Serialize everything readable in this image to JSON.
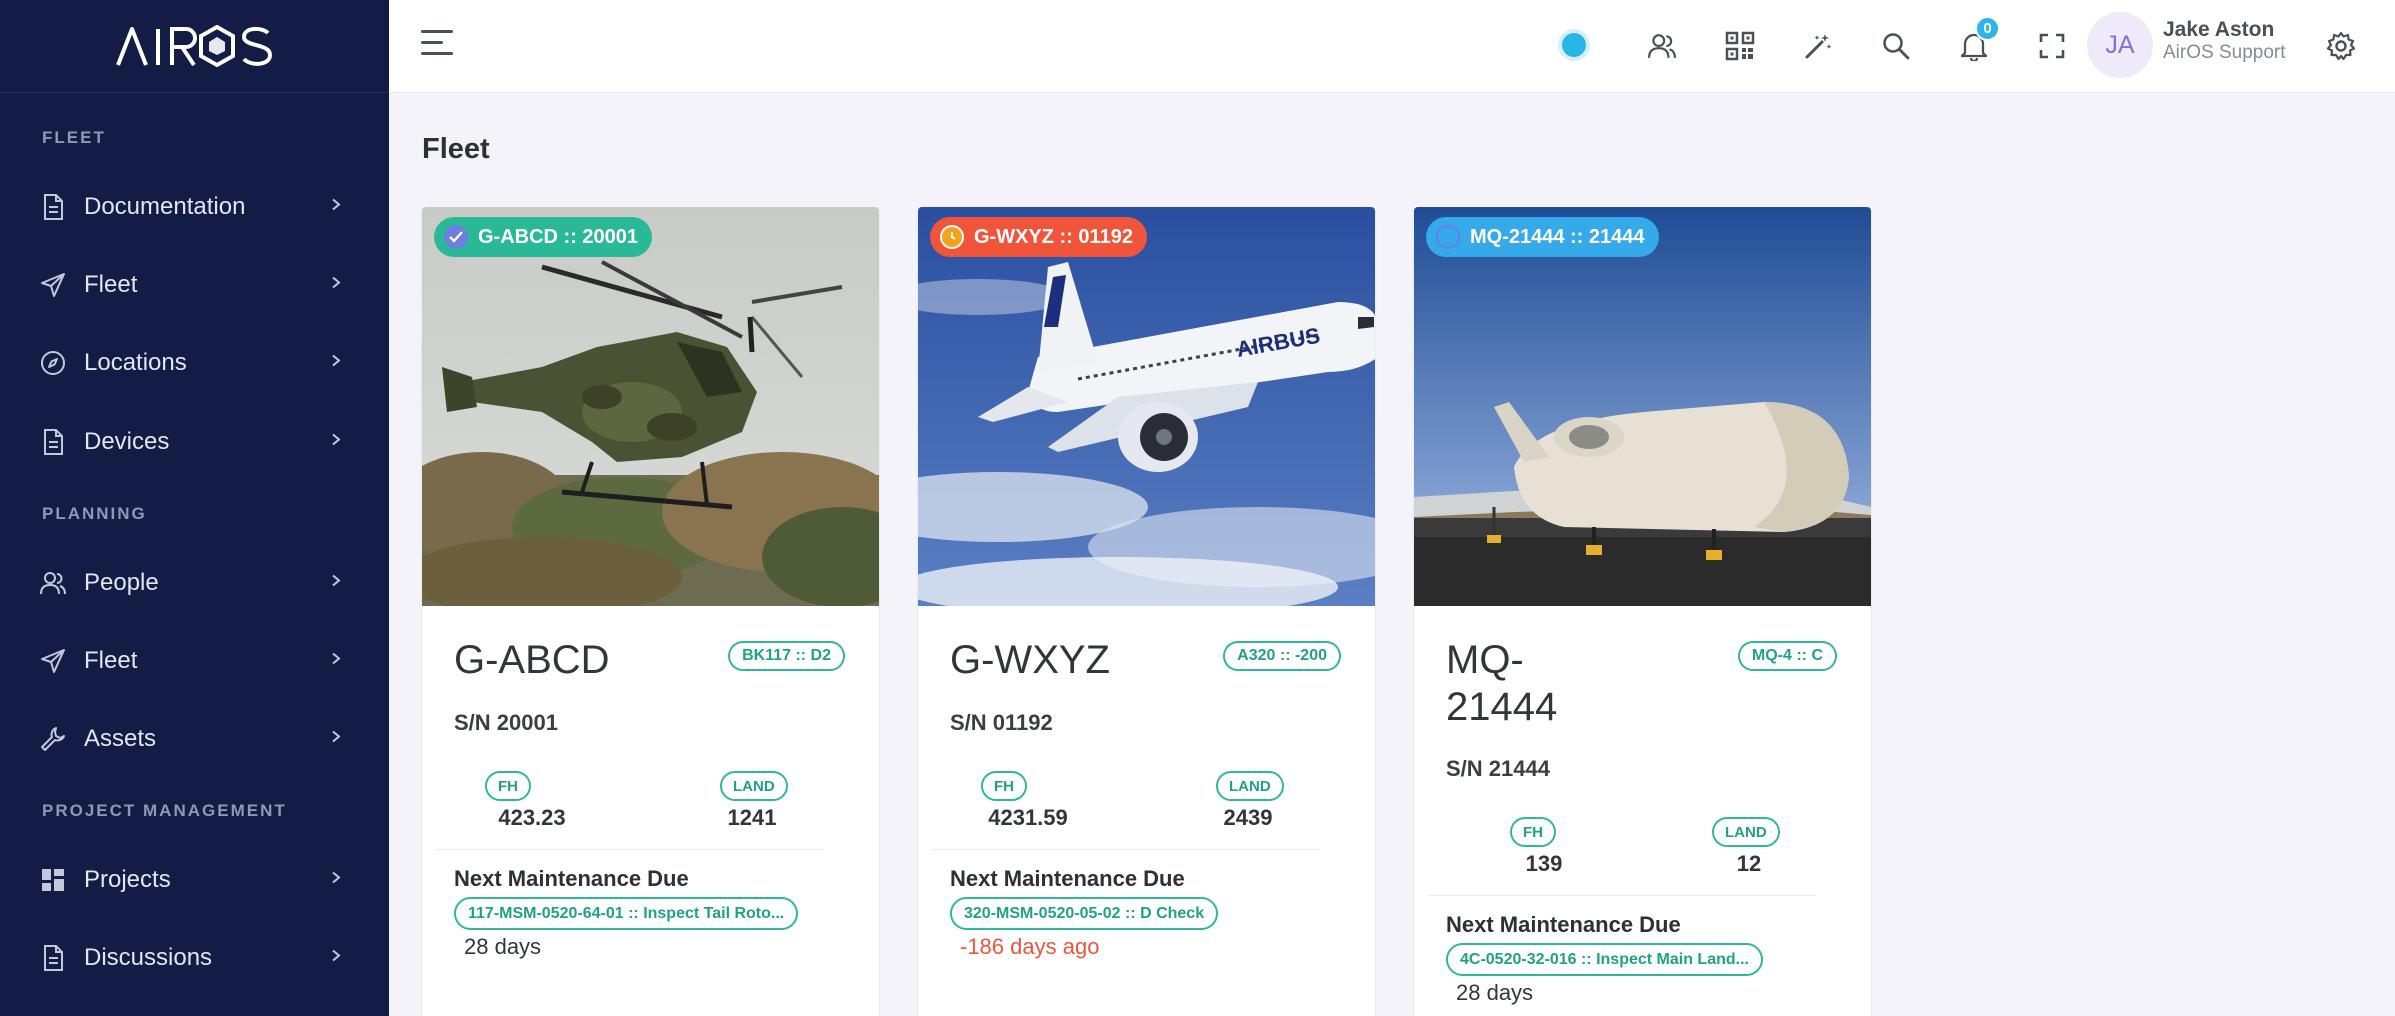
{
  "brand": {
    "logo_text": "AIROS"
  },
  "sidebar": {
    "sections": [
      {
        "title": "FLEET"
      },
      {
        "title": "PLANNING"
      },
      {
        "title": "PROJECT MANAGEMENT"
      }
    ],
    "items": [
      {
        "label": "Documentation",
        "icon": "document-icon"
      },
      {
        "label": "Fleet",
        "icon": "paper-plane-icon"
      },
      {
        "label": "Locations",
        "icon": "compass-icon"
      },
      {
        "label": "Devices",
        "icon": "document-icon"
      },
      {
        "label": "People",
        "icon": "people-icon"
      },
      {
        "label": "Fleet",
        "icon": "paper-plane-icon"
      },
      {
        "label": "Assets",
        "icon": "wrench-icon"
      },
      {
        "label": "Projects",
        "icon": "grid-icon"
      },
      {
        "label": "Discussions",
        "icon": "document-icon"
      }
    ]
  },
  "topbar": {
    "notification_count": "0",
    "user": {
      "initials": "JA",
      "name": "Jake Aston",
      "role": "AirOS Support"
    }
  },
  "page": {
    "title": "Fleet"
  },
  "cards": [
    {
      "pill_label": "G-ABCD :: 20001",
      "pill_status": "complete",
      "pill_color": "#2ab996",
      "tail": "G-ABCD",
      "type": "BK117 :: D2",
      "serial": "S/N 20001",
      "fh_label": "FH",
      "fh_value": "423.23",
      "land_label": "LAND",
      "land_value": "1241",
      "next_title": "Next Maintenance Due",
      "task": "117-MSM-0520-64-01 :: Inspect Tail Roto...",
      "due": "28 days",
      "overdue": false
    },
    {
      "pill_label": "G-WXYZ :: 01192",
      "pill_status": "warning",
      "pill_color": "#f0553a",
      "tail": "G-WXYZ",
      "type": "A320 :: -200",
      "serial": "S/N 01192",
      "fh_label": "FH",
      "fh_value": "4231.59",
      "land_label": "LAND",
      "land_value": "2439",
      "next_title": "Next Maintenance Due",
      "task": "320-MSM-0520-05-02 :: D Check",
      "due": "-186 days ago",
      "overdue": true
    },
    {
      "pill_label": "MQ-21444 :: 21444",
      "pill_status": "pending",
      "pill_color": "#35a9ea",
      "tail_line1": "MQ-",
      "tail_line2": "21444",
      "type": "MQ-4 :: C",
      "serial": "S/N 21444",
      "fh_label": "FH",
      "fh_value": "139",
      "land_label": "LAND",
      "land_value": "12",
      "next_title": "Next Maintenance Due",
      "task": "4C-0520-32-016 :: Inspect Main Land...",
      "due": "28 days",
      "overdue": false
    }
  ]
}
